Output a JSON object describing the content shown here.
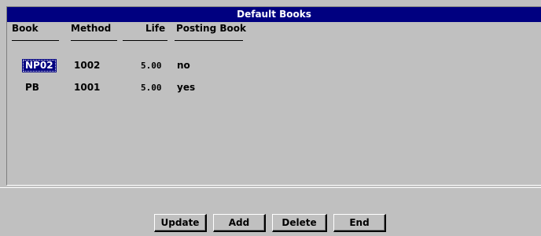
{
  "window": {
    "title": "Default Books"
  },
  "columns": [
    "Book",
    "Method",
    "Life",
    "Posting Book"
  ],
  "rows": [
    {
      "book": "NP02",
      "method": "1002",
      "life": "5.00",
      "posting_book": "no",
      "selected": true
    },
    {
      "book": "PB",
      "method": "1001",
      "life": "5.00",
      "posting_book": "yes",
      "selected": false
    }
  ],
  "buttons": {
    "update": "Update",
    "add": "Add",
    "delete": "Delete",
    "end": "End"
  },
  "colors": {
    "title_bar": "#000080",
    "background": "#c0c0c0",
    "selection": "#000080"
  }
}
